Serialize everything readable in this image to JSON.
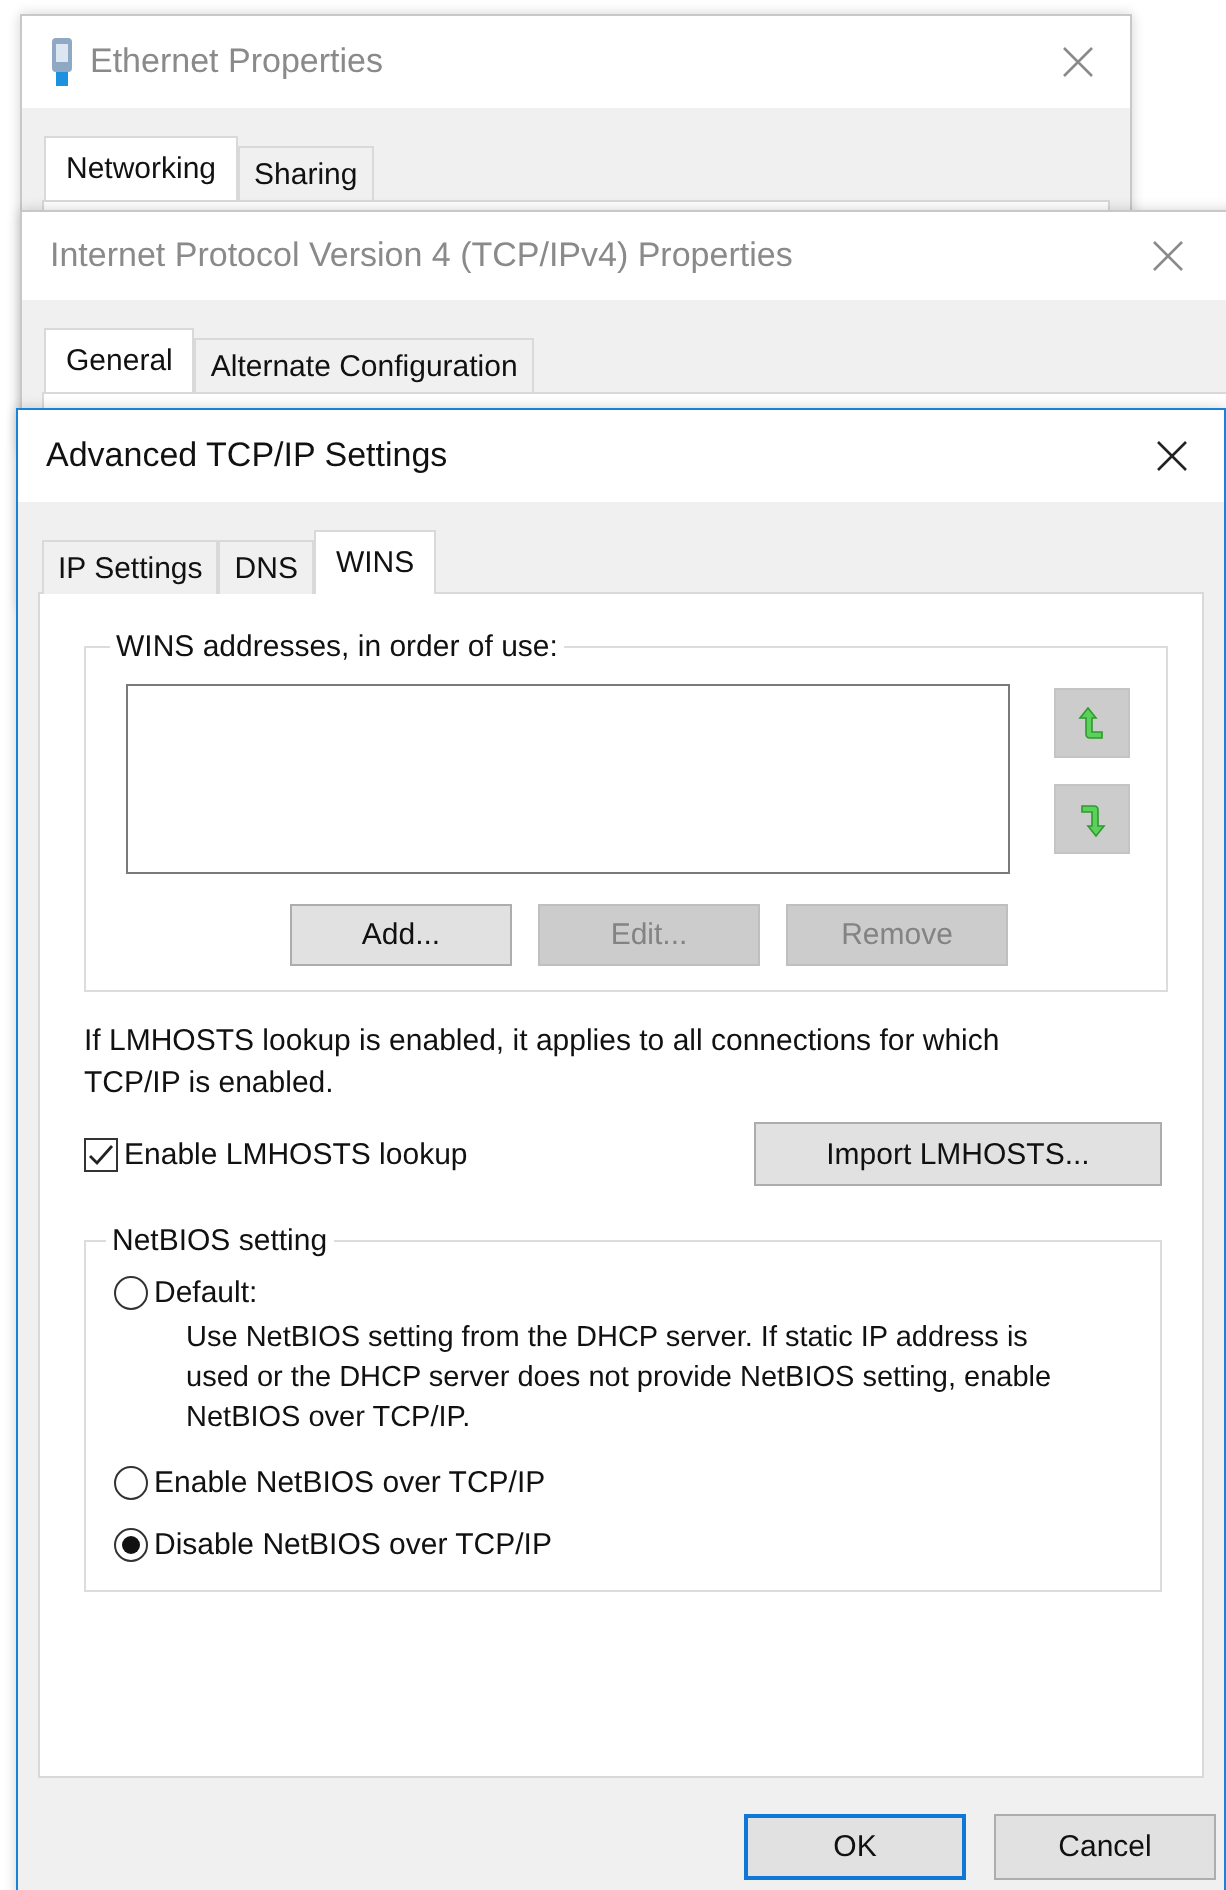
{
  "background_windows": [
    {
      "title": "Ethernet Properties",
      "icon": true,
      "tabs": [
        {
          "label": "Networking",
          "selected": true
        },
        {
          "label": "Sharing",
          "selected": false
        }
      ]
    },
    {
      "title": "Internet Protocol Version 4 (TCP/IPv4) Properties",
      "icon": false,
      "tabs": [
        {
          "label": "General",
          "selected": true
        },
        {
          "label": "Alternate Configuration",
          "selected": false
        }
      ]
    }
  ],
  "dialog": {
    "title": "Advanced TCP/IP Settings",
    "tabs": [
      {
        "label": "IP Settings",
        "selected": false
      },
      {
        "label": "DNS",
        "selected": false
      },
      {
        "label": "WINS",
        "selected": true
      }
    ],
    "wins_group": {
      "label": "WINS addresses, in order of use:",
      "buttons": [
        {
          "label": "Add...",
          "disabled": false
        },
        {
          "label": "Edit...",
          "disabled": true
        },
        {
          "label": "Remove",
          "disabled": true
        }
      ]
    },
    "lmhosts_note": "If LMHOSTS lookup is enabled, it applies to all connections for which TCP/IP is enabled.",
    "lmhosts_checkbox": {
      "label": "Enable LMHOSTS lookup",
      "checked": true
    },
    "import_button": "Import LMHOSTS...",
    "netbios_group": {
      "label": "NetBIOS setting",
      "options": [
        {
          "label": "Default:",
          "description": "Use NetBIOS setting from the DHCP server. If static IP address is used or the DHCP server does not provide NetBIOS setting, enable NetBIOS over TCP/IP.",
          "selected": false
        },
        {
          "label": "Enable NetBIOS over TCP/IP",
          "selected": false
        },
        {
          "label": "Disable NetBIOS over TCP/IP",
          "selected": true
        }
      ]
    },
    "footer_buttons": [
      {
        "label": "OK",
        "default": true
      },
      {
        "label": "Cancel",
        "default": false
      }
    ]
  }
}
